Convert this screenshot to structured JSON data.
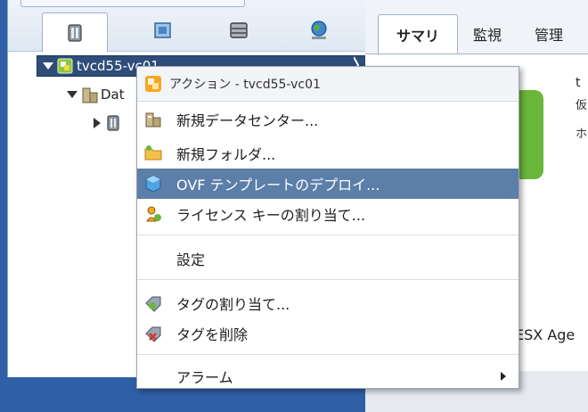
{
  "colors": {
    "background": "#2f5fa6",
    "selection": "#2e4d79",
    "menu_highlight": "#5b7fa8",
    "status_green": "#6ab73b"
  },
  "navigator": {
    "tabs": [
      {
        "icon": "hosts-clusters-icon"
      },
      {
        "icon": "vms-templates-icon"
      },
      {
        "icon": "storage-icon"
      },
      {
        "icon": "networking-icon"
      }
    ],
    "tree": {
      "selected_item": "tvcd55-vc01",
      "child_item": "Dat",
      "grandchild_icon": "host-icon"
    }
  },
  "content": {
    "tabs": [
      {
        "label": "サマリ"
      },
      {
        "label": "監視"
      },
      {
        "label": "管理"
      }
    ],
    "side_text_1": "t",
    "side_text_2": "仮",
    "side_text_3": "ホ",
    "footer_text": "ESX Age"
  },
  "context_menu": {
    "header": "アクション - tvcd55-vc01",
    "items": [
      {
        "label": "新規データセンター...",
        "icon": "new-datacenter-icon"
      },
      {
        "label": "新規フォルダ...",
        "icon": "new-folder-icon"
      },
      {
        "label": "OVF テンプレートのデプロイ...",
        "icon": "deploy-ovf-icon"
      },
      {
        "label": "ライセンス キーの割り当て...",
        "icon": "license-key-icon"
      },
      {
        "label": "設定",
        "icon": ""
      },
      {
        "label": "タグの割り当て...",
        "icon": "assign-tag-icon"
      },
      {
        "label": "タグを削除",
        "icon": "remove-tag-icon"
      },
      {
        "label": "アラーム",
        "icon": ""
      }
    ]
  }
}
